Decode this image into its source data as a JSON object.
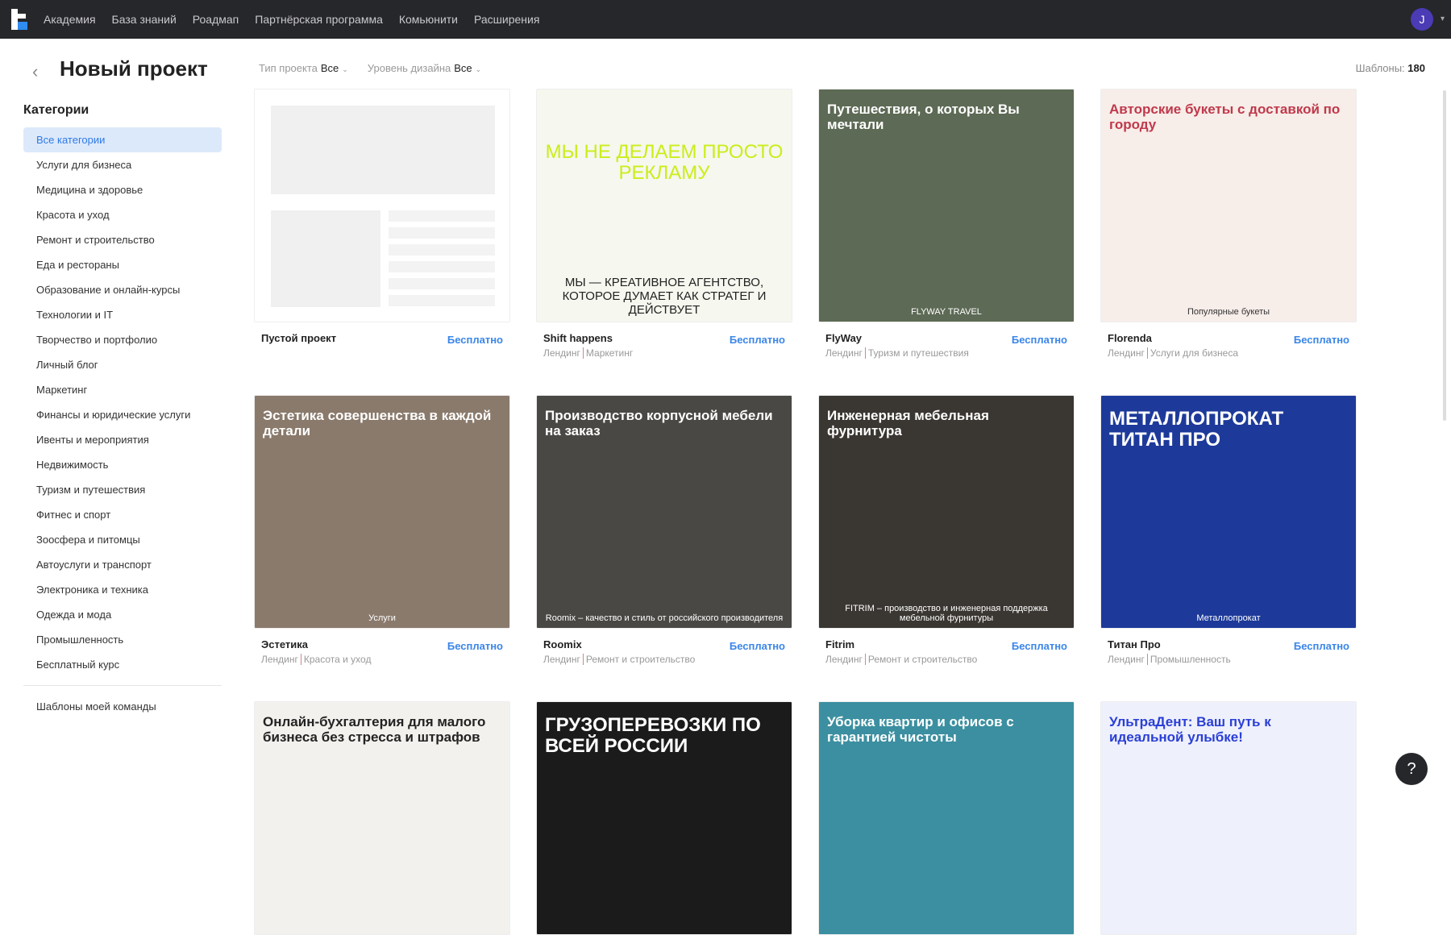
{
  "nav": {
    "items": [
      "Академия",
      "База знаний",
      "Роадмап",
      "Партнёрская программа",
      "Комьюнити",
      "Расширения"
    ],
    "avatar": "J"
  },
  "header": {
    "title": "Новый проект",
    "filters": [
      {
        "label": "Тип проекта",
        "value": "Все"
      },
      {
        "label": "Уровень дизайна",
        "value": "Все"
      }
    ],
    "count_label": "Шаблоны:",
    "count": "180"
  },
  "sidebar": {
    "title": "Категории",
    "items": [
      "Все категории",
      "Услуги для бизнеса",
      "Медицина и здоровье",
      "Красота и уход",
      "Ремонт и строительство",
      "Еда и рестораны",
      "Образование и онлайн-курсы",
      "Технологии и IT",
      "Творчество и портфолио",
      "Личный блог",
      "Маркетинг",
      "Финансы и юридические услуги",
      "Ивенты и мероприятия",
      "Недвижимость",
      "Туризм и путешествия",
      "Фитнес и спорт",
      "Зоосфера и питомцы",
      "Автоуслуги и транспорт",
      "Электроника и техника",
      "Одежда и мода",
      "Промышленность",
      "Бесплатный курс"
    ],
    "team": "Шаблоны моей команды"
  },
  "cards": [
    {
      "name": "Пустой проект",
      "price": "Бесплатно",
      "type": "",
      "cat": "",
      "bg": "#ffffff",
      "headline": "",
      "fg": "#000"
    },
    {
      "name": "Shift happens",
      "price": "Бесплатно",
      "type": "Лендинг",
      "cat": "Маркетинг",
      "bg": "#f6f7ee",
      "headline": "МЫ НЕ ДЕЛАЕМ ПРОСТО РЕКЛАМУ",
      "sub": "МЫ — КРЕАТИВНОЕ АГЕНТСТВО, КОТОРОЕ ДУМАЕТ КАК СТРАТЕГ И ДЕЙСТВУЕТ",
      "fg": "#c9ee1a"
    },
    {
      "name": "FlyWay",
      "price": "Бесплатно",
      "type": "Лендинг",
      "cat": "Туризм и путешествия",
      "bg": "#5d6a55",
      "headline": "Путешествия, о которых Вы мечтали",
      "sub": "FLYWAY TRAVEL",
      "fg": "#fff"
    },
    {
      "name": "Florenda",
      "price": "Бесплатно",
      "type": "Лендинг",
      "cat": "Услуги для бизнеса",
      "bg": "#f7ede9",
      "headline": "Авторские букеты с доставкой по городу",
      "sub": "Популярные букеты",
      "fg": "#c0394b"
    },
    {
      "name": "Эстетика",
      "price": "Бесплатно",
      "type": "Лендинг",
      "cat": "Красота и уход",
      "bg": "#8a7a6c",
      "headline": "Эстетика совершенства в каждой детали",
      "sub": "Услуги",
      "fg": "#fff"
    },
    {
      "name": "Roomix",
      "price": "Бесплатно",
      "type": "Лендинг",
      "cat": "Ремонт и строительство",
      "bg": "#4a4845",
      "headline": "Производство корпусной мебели на заказ",
      "sub": "Roomix – качество и стиль от российского производителя",
      "fg": "#fff"
    },
    {
      "name": "Fitrim",
      "price": "Бесплатно",
      "type": "Лендинг",
      "cat": "Ремонт и строительство",
      "bg": "#3a3632",
      "headline": "Инженерная мебельная фурнитура",
      "sub": "FITRIM – производство и инженерная поддержка мебельной фурнитуры",
      "fg": "#fff"
    },
    {
      "name": "Титан Про",
      "price": "Бесплатно",
      "type": "Лендинг",
      "cat": "Промышленность",
      "bg": "#1d3a9a",
      "headline": "МЕТАЛЛОПРОКАТ ТИТАН ПРО",
      "sub": "Металлопрокат",
      "fg": "#fff"
    },
    {
      "name": "",
      "price": "",
      "type": "",
      "cat": "",
      "bg": "#f3f1ee",
      "headline": "Онлайн-бухгалтерия для малого бизнеса без стресса и штрафов",
      "fg": "#222"
    },
    {
      "name": "",
      "price": "",
      "type": "",
      "cat": "",
      "bg": "#1b1b1b",
      "headline": "ГРУЗОПЕРЕВОЗКИ ПО ВСЕЙ РОССИИ",
      "fg": "#fff"
    },
    {
      "name": "",
      "price": "",
      "type": "",
      "cat": "",
      "bg": "#3b8fa0",
      "headline": "Уборка квартир и офисов с гарантией чистоты",
      "fg": "#fff"
    },
    {
      "name": "",
      "price": "",
      "type": "",
      "cat": "",
      "bg": "#eef0fb",
      "headline": "УльтраДент: Ваш путь к идеальной улыбке!",
      "fg": "#2a3fd6"
    }
  ],
  "help": "?"
}
